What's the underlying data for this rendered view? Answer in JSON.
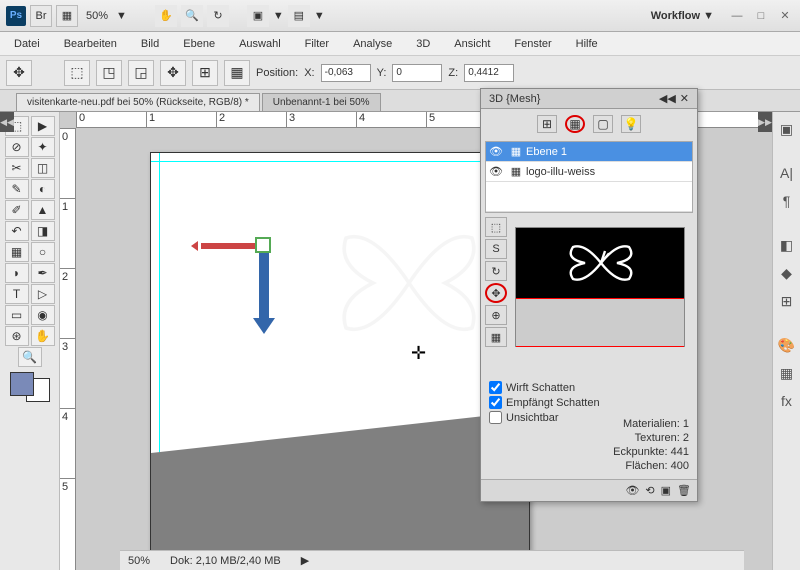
{
  "titlebar": {
    "zoom": "50%",
    "workflow": "Workflow ▼"
  },
  "menu": [
    "Datei",
    "Bearbeiten",
    "Bild",
    "Ebene",
    "Auswahl",
    "Filter",
    "Analyse",
    "3D",
    "Ansicht",
    "Fenster",
    "Hilfe"
  ],
  "options": {
    "position_label": "Position:",
    "x_label": "X:",
    "x_val": "-0,063",
    "y_label": "Y:",
    "y_val": "0",
    "z_label": "Z:",
    "z_val": "0,4412"
  },
  "tabs": {
    "a": "visitenkarte-neu.pdf bei 50% (Rückseite, RGB/8) * ",
    "b": "Unbenannt-1 bei 50%"
  },
  "ruler_h": [
    "0",
    "1",
    "2",
    "3",
    "4",
    "5"
  ],
  "ruler_v": [
    "0",
    "1",
    "2",
    "3",
    "4",
    "5"
  ],
  "panel": {
    "title": "3D {Mesh}",
    "layers": [
      {
        "name": "Ebene 1"
      },
      {
        "name": "logo-illu-weiss"
      }
    ],
    "check1": "Wirft Schatten",
    "check2": "Empfängt Schatten",
    "check3": "Unsichtbar",
    "stat1": "Materialien: 1",
    "stat2": "Texturen: 2",
    "stat3": "Eckpunkte: 441",
    "stat4": "Flächen: 400"
  },
  "status": {
    "zoom": "50%",
    "dok": "Dok: 2,10 MB/2,40 MB"
  }
}
